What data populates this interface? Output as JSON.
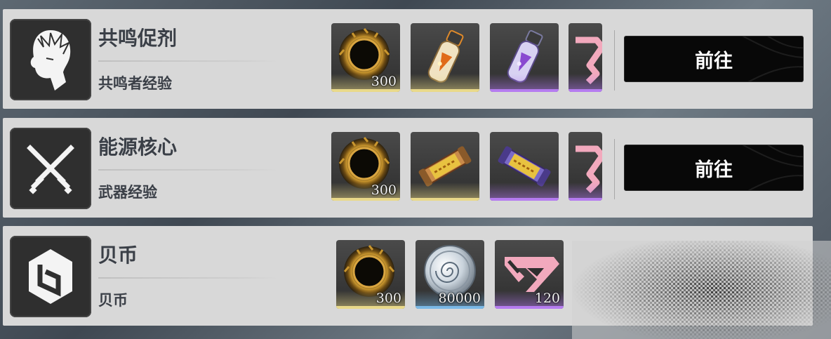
{
  "rows": [
    {
      "title": "共鸣促剂",
      "subtitle": "共鸣者经验",
      "icon": "resonator-head-icon",
      "items": [
        {
          "icon": "shell-credit-ring-icon",
          "qty": "300",
          "rarity": "gold"
        },
        {
          "icon": "gold-potion-vial-icon",
          "qty": "",
          "rarity": "gold"
        },
        {
          "icon": "purple-potion-vial-icon",
          "qty": "",
          "rarity": "purple"
        },
        {
          "icon": "pink-tuner-icon",
          "qty": "",
          "rarity": "purple"
        }
      ],
      "button": "前往"
    },
    {
      "title": "能源核心",
      "subtitle": "武器经验",
      "icon": "crossed-swords-icon",
      "items": [
        {
          "icon": "shell-credit-ring-icon",
          "qty": "300",
          "rarity": "gold"
        },
        {
          "icon": "gold-energy-core-icon",
          "qty": "",
          "rarity": "gold"
        },
        {
          "icon": "purple-energy-core-icon",
          "qty": "",
          "rarity": "purple"
        },
        {
          "icon": "pink-tuner-icon",
          "qty": "",
          "rarity": "purple"
        }
      ],
      "button": "前往"
    },
    {
      "title": "贝币",
      "subtitle": "贝币",
      "icon": "shell-credit-logo-icon",
      "items": [
        {
          "icon": "shell-credit-ring-icon",
          "qty": "300",
          "rarity": "gold"
        },
        {
          "icon": "silver-coin-icon",
          "qty": "80000",
          "rarity": "blue"
        },
        {
          "icon": "pink-tuner-icon",
          "qty": "120",
          "rarity": "purple"
        }
      ],
      "button": ""
    }
  ],
  "colors": {
    "gold": "#e9d98a",
    "purple": "#b57cf0",
    "blue": "#7ab8e6",
    "pink": "#f2a9bd"
  }
}
